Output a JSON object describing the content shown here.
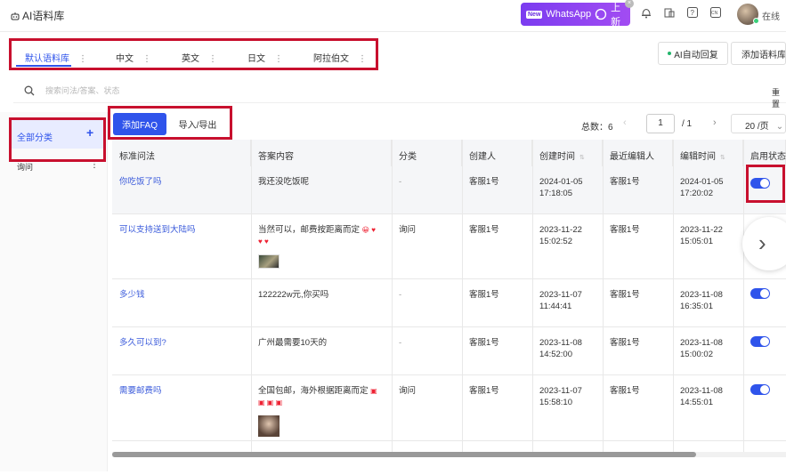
{
  "header": {
    "app_title": "AI语料库",
    "banner": {
      "new_badge": "New",
      "text": "WhatsApp",
      "suffix": "上新"
    },
    "icons": [
      "bell-icon",
      "window-icon",
      "help-icon",
      "language-icon"
    ],
    "lang_badge": "CN",
    "status": "在线"
  },
  "lang_tabs": [
    {
      "label": "默认语料库"
    },
    {
      "label": "中文"
    },
    {
      "label": "英文"
    },
    {
      "label": "日文"
    },
    {
      "label": "阿拉伯文"
    }
  ],
  "toolbar": {
    "ai_reply_label": "AI自动回复",
    "add_library_label": "添加语料库"
  },
  "search": {
    "placeholder": "搜索问法/答案、状态",
    "reset_label": "重置"
  },
  "sidebar": {
    "all_label": "全部分类",
    "items": [
      {
        "label": "询问"
      }
    ]
  },
  "actions": {
    "add_faq_label": "添加FAQ",
    "import_export_label": "导入/导出"
  },
  "pagination": {
    "total_label": "总数：6",
    "current_page": "1",
    "total_pages": "/ 1",
    "page_size": "20 /页"
  },
  "table": {
    "headers": [
      "标准问法",
      "答案内容",
      "分类",
      "创建人",
      "创建时间",
      "最近编辑人",
      "编辑时间",
      "启用状态"
    ],
    "rows": [
      {
        "question": "你吃饭了吗",
        "answer": "我还没吃饭呢",
        "category": "-",
        "creator": "客服1号",
        "created_date": "2024-01-05",
        "created_time": "17:18:05",
        "editor": "客服1号",
        "edited_date": "2024-01-05",
        "edited_time": "17:20:02",
        "enabled": true
      },
      {
        "question": "可以支持送到大陆吗",
        "answer": "当然可以，邮费按距离而定",
        "category": "询问",
        "creator": "客服1号",
        "created_date": "2023-11-22",
        "created_time": "15:02:52",
        "editor": "客服1号",
        "edited_date": "2023-11-22",
        "edited_time": "15:05:01",
        "enabled": true
      },
      {
        "question": "多少钱",
        "answer": "122222w元,你买吗",
        "category": "-",
        "creator": "客服1号",
        "created_date": "2023-11-07",
        "created_time": "11:44:41",
        "editor": "客服1号",
        "edited_date": "2023-11-08",
        "edited_time": "16:35:01",
        "enabled": true
      },
      {
        "question": "多久可以到?",
        "answer": "广州最需要10天的",
        "category": "-",
        "creator": "客服1号",
        "created_date": "2023-11-08",
        "created_time": "14:52:00",
        "editor": "客服1号",
        "edited_date": "2023-11-08",
        "edited_time": "15:00:02",
        "enabled": true
      },
      {
        "question": "需要邮费吗",
        "answer": "全国包邮，海外根据距离而定",
        "category": "询问",
        "creator": "客服1号",
        "created_date": "2023-11-07",
        "created_time": "15:58:10",
        "editor": "客服1号",
        "edited_date": "2023-11-08",
        "edited_time": "14:55:01",
        "enabled": true
      }
    ]
  },
  "colors": {
    "primary": "#2f54eb",
    "highlight_border": "#c8102e",
    "banner_purple": "#7b3cf0"
  }
}
